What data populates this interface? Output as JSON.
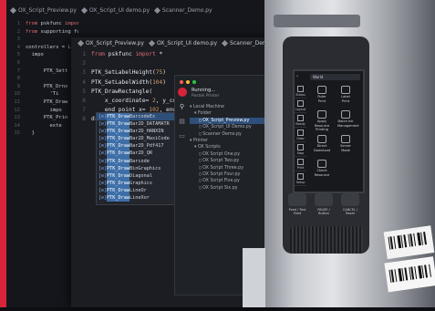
{
  "back_editor": {
    "tabs": [
      "OX_Script_Preview.py",
      "OX_Script_UI demo.py",
      "Scanner_Demo.py"
    ],
    "lines": [
      {
        "num": "1",
        "text": "from pskfunc import *"
      },
      {
        "num": "2",
        "text": "from supporting functions import *"
      },
      {
        "num": "3",
        "text": ""
      },
      {
        "num": "4",
        "text": "controllers = Li"
      },
      {
        "num": "5",
        "text": "  impo"
      },
      {
        "num": "6",
        "text": ""
      },
      {
        "num": "7",
        "text": "      PTK_Sett"
      },
      {
        "num": "8",
        "text": ""
      },
      {
        "num": "9",
        "text": "      PTK_Drnx"
      },
      {
        "num": "10",
        "text": "        'Ti"
      },
      {
        "num": "11",
        "text": "      PTK_Draw"
      },
      {
        "num": "12",
        "text": "        impo"
      },
      {
        "num": "13",
        "text": "      PTK_Prin"
      },
      {
        "num": "14",
        "text": "        exte"
      },
      {
        "num": "15",
        "text": "  }"
      }
    ]
  },
  "mid_editor": {
    "tabs": [
      "OX_Script_Preview.py",
      "OX_Script_UI demo.py",
      "Scanner_Demo.py"
    ],
    "lines": [
      {
        "num": "1",
        "text": "from pskfunc import *"
      },
      {
        "num": "2",
        "text": ""
      },
      {
        "num": "3",
        "text": "PTK_SetLabelHeight(75)"
      },
      {
        "num": "4",
        "text": "PTK_SetLabelWidth(104)"
      },
      {
        "num": "5",
        "text": "PTK_DrawRectangle("
      },
      {
        "num": "6",
        "text": "    x_coordinate= 2, y_coordi"
      },
      {
        "num": "7",
        "text": "    end_point_x= 102, end_poi"
      },
      {
        "num": "8",
        "text": "draw"
      }
    ]
  },
  "autocomplete": {
    "prefix": "PTK_Draw",
    "items": [
      {
        "icon": "[e]",
        "suffix": "BarcodeEx"
      },
      {
        "icon": "[e]",
        "suffix": "Bar2D_DATAMATR"
      },
      {
        "icon": "[e]",
        "suffix": "Bar2D_HANXIN"
      },
      {
        "icon": "[e]",
        "suffix": "Bar2D_MaxiCode"
      },
      {
        "icon": "[e]",
        "suffix": "Bar2D_Pdf417"
      },
      {
        "icon": "[e]",
        "suffix": "Bar2D_QR"
      },
      {
        "icon": "[e]",
        "suffix": "Barcode"
      },
      {
        "icon": "[e]",
        "suffix": "BinGraphics"
      },
      {
        "icon": "[e]",
        "suffix": "Diagonal"
      },
      {
        "icon": "[e]",
        "suffix": "Graphics"
      },
      {
        "icon": "[e]",
        "suffix": "LineOr"
      },
      {
        "icon": "[e]",
        "suffix": "LineXor"
      }
    ]
  },
  "run_panel": {
    "status": "Running...",
    "device": "Postek Printer",
    "tree": [
      {
        "level": 0,
        "text": "Local Machine"
      },
      {
        "level": 1,
        "text": "Folder"
      },
      {
        "level": 2,
        "text": "OX_Script_Preview.py",
        "selected": true
      },
      {
        "level": 2,
        "text": "OX_Script_UI Demo.py"
      },
      {
        "level": 2,
        "text": "Scanner Demo.py"
      },
      {
        "level": 0,
        "text": ""
      },
      {
        "level": 0,
        "text": "Printer"
      },
      {
        "level": 1,
        "text": "OX Scripts"
      },
      {
        "level": 2,
        "text": "OX Script One.py"
      },
      {
        "level": 2,
        "text": "OX Script Two.py"
      },
      {
        "level": 2,
        "text": "OX Script Three.py"
      },
      {
        "level": 2,
        "text": "OX Script Four.py"
      },
      {
        "level": 2,
        "text": "OX Script Five.py"
      },
      {
        "level": 2,
        "text": "OX Script Six.py"
      }
    ]
  },
  "printer_screen": {
    "title": "World",
    "side_items": [
      "Status",
      "Layout",
      "Ready",
      "Clear",
      "Stop",
      "Print",
      "Setup"
    ],
    "icons": [
      "Ruler Print",
      "Label Print",
      "Apply Resource Printing",
      "Batch Ink Management",
      "Direct Download",
      "Server Mode",
      "Check Resource"
    ]
  },
  "printer_buttons": [
    "Feed / Test Feed",
    "PAUSE / Button",
    "CANCEL / Reset"
  ],
  "colors": {
    "accent_red": "#d8233a",
    "highlight_blue": "#2f4f7a"
  }
}
